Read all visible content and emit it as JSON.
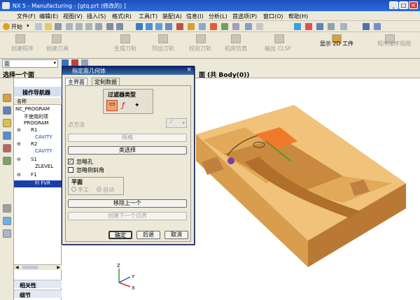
{
  "window": {
    "title": "NX 5 - Manufacturing - [gtq.prt (修改的) ]",
    "min_glyph": "_",
    "max_glyph": "□",
    "close_glyph": "×"
  },
  "menubar": {
    "items": [
      "文件(F)",
      "编辑(E)",
      "视图(V)",
      "插入(S)",
      "格式(R)",
      "工具(T)",
      "装配(A)",
      "信息(I)",
      "分析(L)",
      "首选项(P)",
      "窗口(O)",
      "帮助(H)"
    ]
  },
  "toolbar1": {
    "start_label": "开始",
    "start_caret": "▾"
  },
  "toolbar2": {
    "items": [
      "创建程序",
      "创建刀具",
      "生成刀轨",
      "列出刀轨",
      "校验刀轨",
      "机床仿真",
      "输出 CLSF",
      "显示 2D 工件",
      "程序顺序视图"
    ]
  },
  "selbar": {
    "filter_value": "面",
    "filter_caret": "▾"
  },
  "statusbar": {
    "left_text": "选择一个面",
    "right_text": "面 (共 Body(0))"
  },
  "navigator": {
    "title": "操作导航器",
    "column_header": "名称",
    "rows": [
      "NC_PROGRAM",
      "不使用的项",
      "PROGRAM",
      "R1",
      "CAVITY",
      "R2",
      "CAVITY",
      "S1",
      "ZLEVEL",
      "F1",
      "FI FVR"
    ],
    "panels": [
      "相关性",
      "细节"
    ],
    "expand_glyph": "⊖",
    "scroll_up": "▲",
    "scroll_down": "▼",
    "scroll_left": "◀",
    "scroll_right": "▶"
  },
  "dialog": {
    "title": "指定面几何体",
    "tabs": [
      "主界面",
      "定制数据"
    ],
    "filter_group_label": "过滤器类型",
    "filter_glyphs": [
      "▭",
      "ƒ",
      "✦"
    ],
    "point_method_label": "点方法",
    "point_method_glyph": "⁄",
    "point_method_caret": "▾",
    "spec_button": "规格",
    "class_select_button": "类选择",
    "ignore_holes_label": "忽略孔",
    "ignore_chamfers_label": "忽略倒斜角",
    "plane_label": "平面",
    "manual_label": "手工",
    "auto_label": "自动",
    "remove_previous_button": "移除上一个",
    "create_next_boundary_button": "创建下一个边界",
    "ok_button": "确定",
    "back_button": "后退",
    "cancel_button": "取消",
    "close_glyph": "×"
  },
  "triad": {
    "x": "X",
    "y": "Y",
    "z": "Z"
  },
  "colors": {
    "model_face": "#d99e4d",
    "model_dark": "#b97934",
    "model_top": "#f0c27a",
    "highlight_face": "#f07a2a",
    "titlebar": "#1e4fb8",
    "wcs_green": "#2aa02a"
  }
}
